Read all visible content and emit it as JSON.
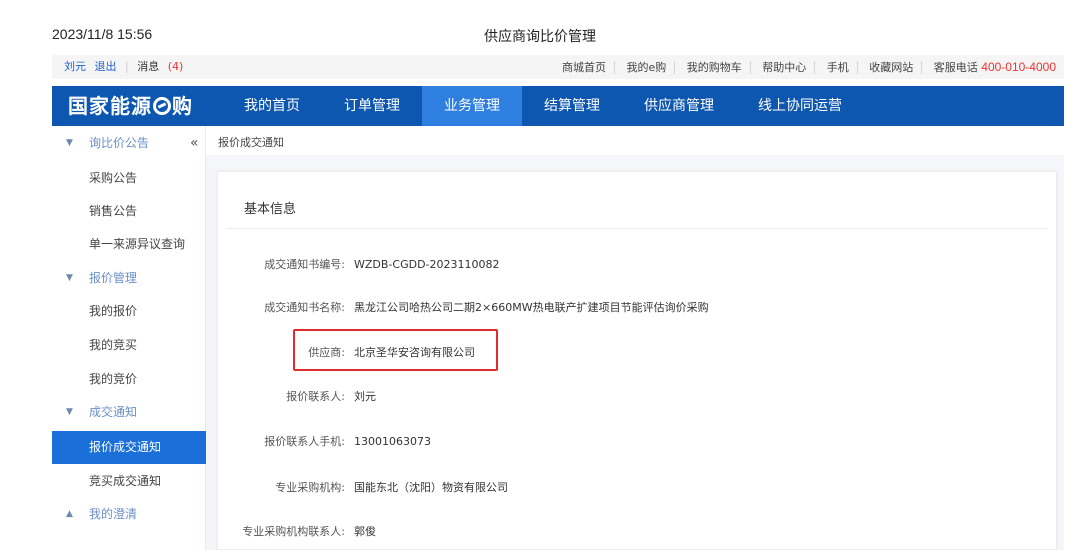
{
  "print_header": {
    "datetime": "2023/11/8 15:56",
    "title": "供应商询比价管理"
  },
  "topbar": {
    "user": "刘元",
    "logout": "退出",
    "messages_label": "消息",
    "messages_count": "(4)",
    "links": [
      "商城首页",
      "我的e购",
      "我的购物车",
      "帮助中心",
      "手机",
      "收藏网站"
    ],
    "hotline_label": "客服电话",
    "hotline_number": "400-010-4000"
  },
  "nav": {
    "logo_prefix": "国家能源",
    "logo_suffix": "购",
    "items": [
      "我的首页",
      "订单管理",
      "业务管理",
      "结算管理",
      "供应商管理",
      "线上协同运营"
    ],
    "active_index": 2
  },
  "sidebar": {
    "rows": [
      {
        "type": "group",
        "label": "询比价公告",
        "expanded": true
      },
      {
        "type": "item",
        "label": "采购公告"
      },
      {
        "type": "item",
        "label": "销售公告"
      },
      {
        "type": "item",
        "label": "单一来源异议查询"
      },
      {
        "type": "group",
        "label": "报价管理",
        "expanded": true
      },
      {
        "type": "item",
        "label": "我的报价"
      },
      {
        "type": "item",
        "label": "我的竞买"
      },
      {
        "type": "item",
        "label": "我的竞价"
      },
      {
        "type": "group",
        "label": "成交通知",
        "expanded": true
      },
      {
        "type": "item",
        "label": "报价成交通知",
        "active": true
      },
      {
        "type": "item",
        "label": "竞买成交通知"
      },
      {
        "type": "group",
        "label": "我的澄清",
        "expanded": false
      }
    ]
  },
  "breadcrumb": "报价成交通知",
  "card": {
    "title": "基本信息",
    "fields": [
      {
        "label": "成交通知书编号:",
        "value": "WZDB-CGDD-2023110082"
      },
      {
        "label": "成交通知书名称:",
        "value": "黑龙江公司哈热公司二期2×660MW热电联产扩建项目节能评估询价采购"
      },
      {
        "label": "供应商:",
        "value": "北京圣华安咨询有限公司"
      },
      {
        "label": "报价联系人:",
        "value": "刘元"
      },
      {
        "label": "报价联系人手机:",
        "value": "13001063073"
      },
      {
        "label": "专业采购机构:",
        "value": "国能东北（沈阳）物资有限公司"
      },
      {
        "label": "专业采购机构联系人:",
        "value": "郭俊"
      }
    ]
  },
  "colors": {
    "nav_bg": "#0d57b0",
    "nav_active": "#2f7fe0",
    "sidebar_active": "#1a6fd8",
    "highlight": "#e32b2b",
    "hotline": "#e33333"
  }
}
